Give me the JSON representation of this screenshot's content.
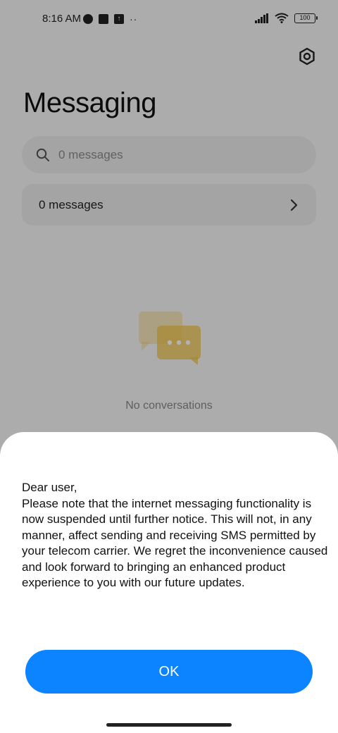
{
  "status_bar": {
    "time": "8:16 AM",
    "battery": "100"
  },
  "header": {
    "title": "Messaging"
  },
  "search": {
    "placeholder": "0 messages"
  },
  "messages_card": {
    "label": "0 messages"
  },
  "empty_state": {
    "text": "No conversations"
  },
  "dialog": {
    "message": "Dear user,\nPlease note that the internet messaging functionality is now suspended until further notice. This will not, in any manner, affect sending and receiving SMS permitted by your telecom carrier. We regret the inconvenience caused and look forward to bringing an enhanced product experience to you with our future updates.",
    "ok_label": "OK"
  },
  "colors": {
    "accent": "#0d84ff",
    "illustration": "#f3c64a"
  },
  "icons": [
    "settings-icon",
    "search-icon",
    "chevron-right-icon",
    "chat-bubbles-icon",
    "signal-icon",
    "wifi-icon",
    "battery-icon"
  ]
}
